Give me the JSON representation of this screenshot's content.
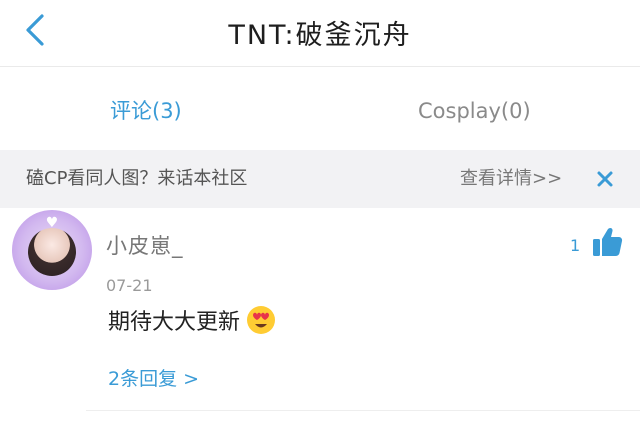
{
  "header": {
    "title": "TNT:破釜沉舟"
  },
  "tabs": [
    {
      "label": "评论(3)",
      "active": true
    },
    {
      "label": "Cosplay(0)",
      "active": false
    }
  ],
  "banner": {
    "text": "磕CP看同人图？来话本社区",
    "link": "查看详情>>"
  },
  "comment": {
    "username": "小皮崽_",
    "likes": "1",
    "date": "07-21",
    "content": "期待大大更新",
    "emoji": "heart-eyes-emoji",
    "replies": "2条回复 >"
  },
  "colors": {
    "accent": "#3a9bd6",
    "banner_bg": "#f2f2f4"
  }
}
